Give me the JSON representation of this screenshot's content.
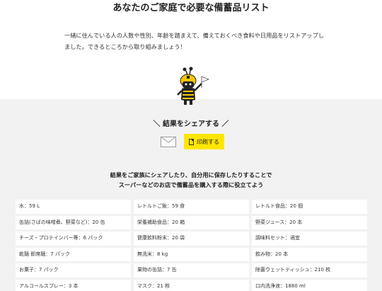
{
  "header": {
    "title": "あなたのご家庭で必要な備蓄品リスト",
    "intro": "一緒に住んでいる人の人数や性別、年齢を踏まえて、備えておくべき食料や日用品をリストアップしました。できるところから取り組みましょう！"
  },
  "share": {
    "title": "＼ 結果をシェアする ／",
    "print_label": "印刷する",
    "message_line1": "結果をご家族にシェアしたり、自分用に保存したりすることで",
    "message_line2": "スーパーなどのお店で備蓄品を購入する際に役立てよう"
  },
  "items": [
    "水：59 L",
    "レトルトご飯：59 食",
    "レトルト食品：20 個",
    "缶詰(さばの味噌煮、野菜など)：20 缶",
    "栄養補助食品：20 箱",
    "野菜ジュース：20 本",
    "チーズ・プロテインバー等：6 パック",
    "健康飲料粉末：20 袋",
    "調味料セット：適宜",
    "乾麺 即席麺：7 パック",
    "無洗米：8 kg",
    "飲み物：20 本",
    "お菓子：7 パック",
    "果物の缶詰：7 缶",
    "除菌ウェットティッシュ：210 枚",
    "アルコールスプレー：3 本",
    "マスク：21 枚",
    "口内洗浄液：1880 ml"
  ],
  "colors": {
    "accent": "#ffe600",
    "section_bg": "#f2f2f2"
  },
  "icons": {
    "mascot": "mascot-character",
    "mail": "mail-icon",
    "print": "document-icon"
  }
}
